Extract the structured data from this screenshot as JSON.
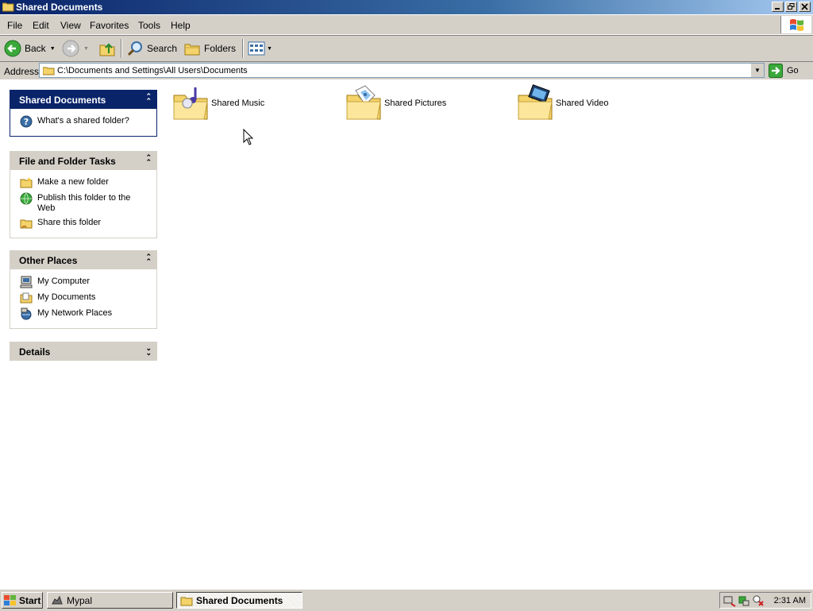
{
  "window": {
    "title": "Shared Documents"
  },
  "menu": {
    "items": [
      "File",
      "Edit",
      "View",
      "Favorites",
      "Tools",
      "Help"
    ]
  },
  "toolbar": {
    "back_label": "Back",
    "search_label": "Search",
    "folders_label": "Folders"
  },
  "address": {
    "label": "Address",
    "path": "C:\\Documents and Settings\\All Users\\Documents",
    "go_label": "Go"
  },
  "sidebar": {
    "shared": {
      "title": "Shared Documents",
      "items": [
        "What's a shared folder?"
      ]
    },
    "tasks": {
      "title": "File and Folder Tasks",
      "items": [
        "Make a new folder",
        "Publish this folder to the Web",
        "Share this folder"
      ]
    },
    "places": {
      "title": "Other Places",
      "items": [
        "My Computer",
        "My Documents",
        "My Network Places"
      ]
    },
    "details": {
      "title": "Details"
    }
  },
  "folders": [
    {
      "name": "Shared Music",
      "icon": "music-folder-icon"
    },
    {
      "name": "Shared Pictures",
      "icon": "pictures-folder-icon"
    },
    {
      "name": "Shared Video",
      "icon": "video-folder-icon"
    }
  ],
  "taskbar": {
    "start_label": "Start",
    "tasks": [
      "Mypal",
      "Shared Documents"
    ],
    "clock": "2:31 AM"
  },
  "colors": {
    "title_bar": "#0a246a",
    "chrome": "#d4d0c8",
    "panel_header_active": "#0a246a"
  }
}
